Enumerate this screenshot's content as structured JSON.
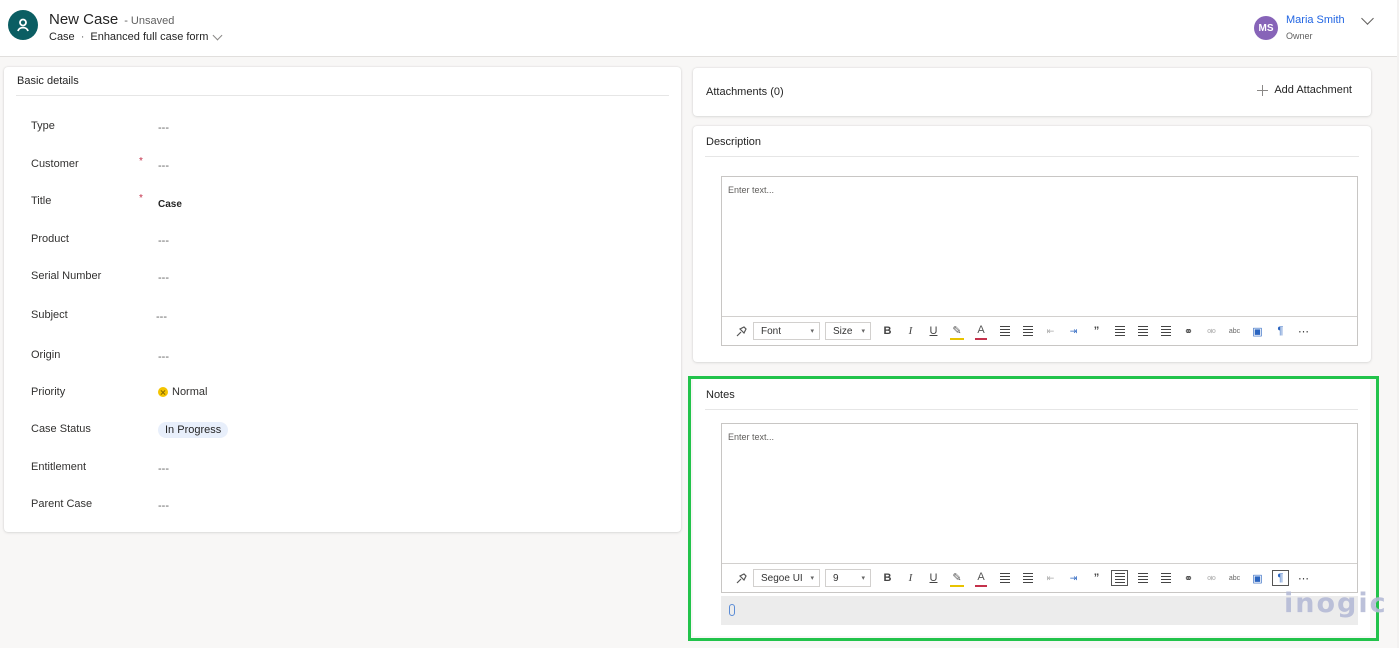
{
  "header": {
    "title": "New Case",
    "unsaved": "- Unsaved",
    "entity": "Case",
    "separator": "·",
    "form_name": "Enhanced full case form",
    "owner": {
      "initials": "MS",
      "name": "Maria Smith",
      "role": "Owner",
      "avatar_color": "#8764b8"
    },
    "icons": {
      "entity": "case-icon",
      "form_chevron": "chevron-down-icon",
      "header_chevron": "chevron-down-icon"
    }
  },
  "basic_details": {
    "title": "Basic details",
    "fields": [
      {
        "label": "Type",
        "required": false,
        "value": "---"
      },
      {
        "label": "Customer",
        "required": true,
        "value": "---"
      },
      {
        "label": "Title",
        "required": true,
        "value": "Case"
      },
      {
        "label": "Product",
        "required": false,
        "value": "---"
      },
      {
        "label": "Serial Number",
        "required": false,
        "value": "---"
      },
      {
        "label": "Subject",
        "required": false,
        "value": "---"
      },
      {
        "label": "Origin",
        "required": false,
        "value": "---"
      },
      {
        "label": "Priority",
        "required": false,
        "value": "Normal"
      },
      {
        "label": "Case Status",
        "required": false,
        "value": "In Progress"
      },
      {
        "label": "Entitlement",
        "required": false,
        "value": "---"
      },
      {
        "label": "Parent Case",
        "required": false,
        "value": "---"
      }
    ],
    "required_marker": "*"
  },
  "attachments": {
    "title": "Attachments (0)",
    "add_label": "Add Attachment"
  },
  "description": {
    "title": "Description",
    "placeholder": "Enter text...",
    "font": "Font",
    "size": "Size"
  },
  "notes": {
    "title": "Notes",
    "placeholder": "Enter text...",
    "font": "Segoe UI",
    "size": "9"
  },
  "toolbar": {
    "caret": "▾",
    "bold": "B",
    "italic": "I",
    "underline": "U",
    "highlight": "✎",
    "font_color": "A",
    "quote": "”",
    "link": "⚭",
    "unlink": "⚮",
    "strike": "abc",
    "image": "▣",
    "ltr": "¶",
    "more": "⋯"
  },
  "colors": {
    "accent_green": "#22c34b",
    "brand_teal": "#0b5e63",
    "link_blue": "#2266e3",
    "required_red": "#c4314b"
  },
  "watermark": "inogic"
}
